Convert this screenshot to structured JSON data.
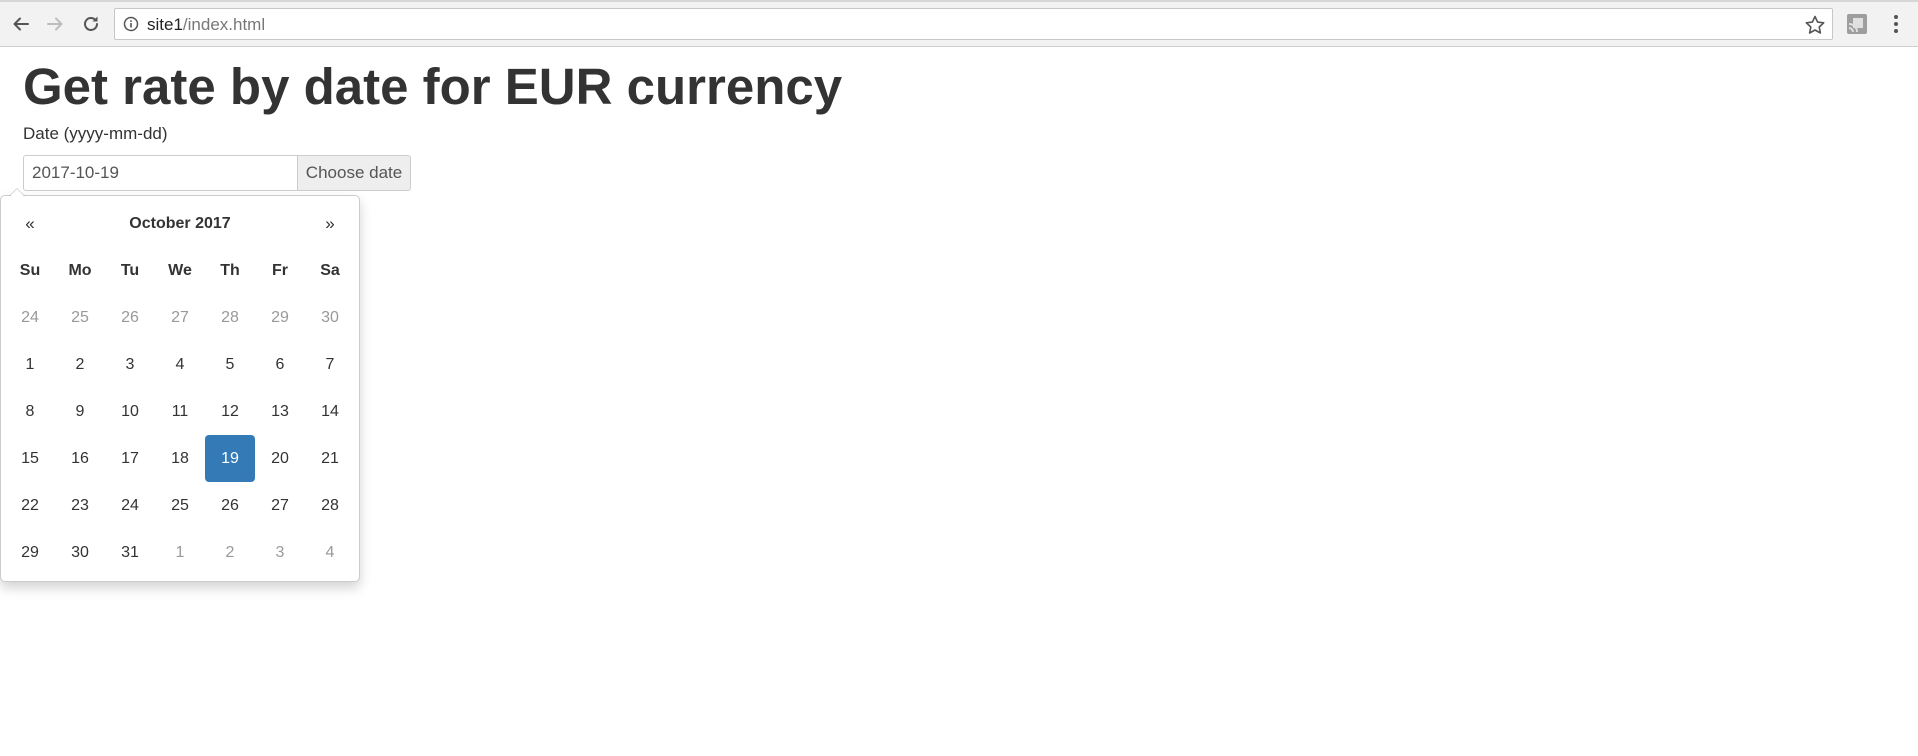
{
  "browser": {
    "url_host": "site1",
    "url_path": "/index.html"
  },
  "page": {
    "title": "Get rate by date for EUR currency",
    "date_label": "Date (yyyy-mm-dd)",
    "date_value": "2017-10-19",
    "choose_button_label": "Choose date"
  },
  "datepicker": {
    "prev_label": "«",
    "next_label": "»",
    "month_label": "October 2017",
    "weekdays": [
      "Su",
      "Mo",
      "Tu",
      "We",
      "Th",
      "Fr",
      "Sa"
    ],
    "selected_day": 19,
    "accent_color": "#337ab7",
    "weeks": [
      [
        {
          "d": "24",
          "t": "old"
        },
        {
          "d": "25",
          "t": "old"
        },
        {
          "d": "26",
          "t": "old"
        },
        {
          "d": "27",
          "t": "old"
        },
        {
          "d": "28",
          "t": "old"
        },
        {
          "d": "29",
          "t": "old"
        },
        {
          "d": "30",
          "t": "old"
        }
      ],
      [
        {
          "d": "1",
          "t": "day"
        },
        {
          "d": "2",
          "t": "day"
        },
        {
          "d": "3",
          "t": "day"
        },
        {
          "d": "4",
          "t": "day"
        },
        {
          "d": "5",
          "t": "day"
        },
        {
          "d": "6",
          "t": "day"
        },
        {
          "d": "7",
          "t": "day"
        }
      ],
      [
        {
          "d": "8",
          "t": "day"
        },
        {
          "d": "9",
          "t": "day"
        },
        {
          "d": "10",
          "t": "day"
        },
        {
          "d": "11",
          "t": "day"
        },
        {
          "d": "12",
          "t": "day"
        },
        {
          "d": "13",
          "t": "day"
        },
        {
          "d": "14",
          "t": "day"
        }
      ],
      [
        {
          "d": "15",
          "t": "day"
        },
        {
          "d": "16",
          "t": "day"
        },
        {
          "d": "17",
          "t": "day"
        },
        {
          "d": "18",
          "t": "day"
        },
        {
          "d": "19",
          "t": "active"
        },
        {
          "d": "20",
          "t": "day"
        },
        {
          "d": "21",
          "t": "day"
        }
      ],
      [
        {
          "d": "22",
          "t": "day"
        },
        {
          "d": "23",
          "t": "day"
        },
        {
          "d": "24",
          "t": "day"
        },
        {
          "d": "25",
          "t": "day"
        },
        {
          "d": "26",
          "t": "day"
        },
        {
          "d": "27",
          "t": "day"
        },
        {
          "d": "28",
          "t": "day"
        }
      ],
      [
        {
          "d": "29",
          "t": "day"
        },
        {
          "d": "30",
          "t": "day"
        },
        {
          "d": "31",
          "t": "day"
        },
        {
          "d": "1",
          "t": "new"
        },
        {
          "d": "2",
          "t": "new"
        },
        {
          "d": "3",
          "t": "new"
        },
        {
          "d": "4",
          "t": "new"
        }
      ]
    ]
  }
}
